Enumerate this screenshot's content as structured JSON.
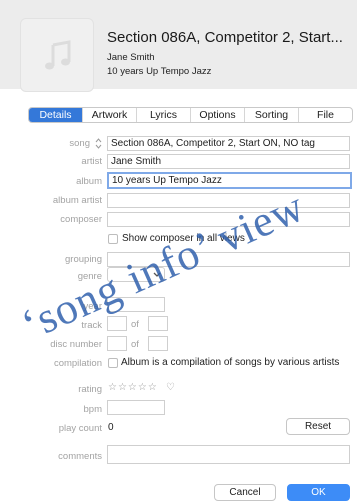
{
  "header": {
    "title": "Section 086A, Competitor 2, Start...",
    "artist": "Jane Smith",
    "album": "10 years Up Tempo Jazz"
  },
  "tabs": [
    {
      "label": "Details",
      "active": true
    },
    {
      "label": "Artwork"
    },
    {
      "label": "Lyrics"
    },
    {
      "label": "Options"
    },
    {
      "label": "Sorting"
    },
    {
      "label": "File"
    }
  ],
  "labels": {
    "song": "song",
    "artist": "artist",
    "album": "album",
    "album_artist": "album artist",
    "composer": "composer",
    "grouping": "grouping",
    "genre": "genre",
    "year": "year",
    "track": "track",
    "of": "of",
    "disc_number": "disc number",
    "compilation": "compilation",
    "rating": "rating",
    "bpm": "bpm",
    "play_count": "play count",
    "comments": "comments"
  },
  "fields": {
    "song": "Section 086A, Competitor 2, Start ON, NO tag",
    "artist": "Jane Smith",
    "album": "10 years Up Tempo Jazz",
    "album_artist": "",
    "composer": "",
    "grouping": "",
    "genre": "",
    "year": "",
    "track": "",
    "track_of": "",
    "disc": "",
    "disc_of": "",
    "bpm": "",
    "comments": ""
  },
  "checkboxes": {
    "show_composer": "Show composer in all views",
    "compilation": "Album is a compilation of songs by various artists"
  },
  "rating": {
    "stars": "☆☆☆☆☆",
    "heart": "♡"
  },
  "play_count": "0",
  "buttons": {
    "reset": "Reset",
    "cancel": "Cancel",
    "ok": "OK"
  },
  "icons": {
    "artwork": "music-note-icon",
    "sort": "sort-arrows-icon",
    "dropdown": "chevron-down-icon"
  },
  "colors": {
    "accent": "#3478d9",
    "ok_button": "#3d8cf7",
    "watermark": "#285aaa"
  },
  "watermark": "‘song info’ view"
}
